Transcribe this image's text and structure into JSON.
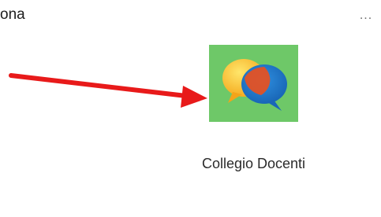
{
  "header": {
    "partial_text": "ona",
    "more_label": "..."
  },
  "team": {
    "name": "Collegio Docenti",
    "icon": "chat-bubbles-icon",
    "tile_color": "#6ec868"
  },
  "annotation": {
    "arrow_color": "#e81a1a",
    "icon": "red-arrow-icon"
  }
}
